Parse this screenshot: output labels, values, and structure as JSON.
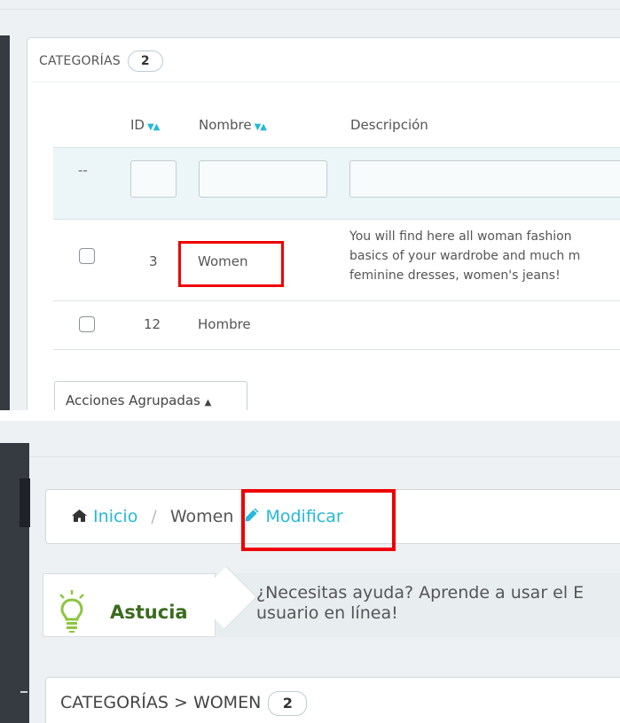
{
  "list": {
    "heading": "CATEGORÍAS",
    "count": "2",
    "columns": {
      "id": "ID",
      "name": "Nombre",
      "description": "Descripción",
      "sort_icon": "▼▲"
    },
    "filter_placeholder": "--",
    "rows": [
      {
        "id": "3",
        "name": "Women",
        "desc_lines": [
          "You will find here all woman fashion",
          "basics of your wardrobe and much m",
          "feminine dresses, women's jeans!"
        ]
      },
      {
        "id": "12",
        "name": "Hombre"
      }
    ],
    "bulk_actions": "Acciones Agrupadas",
    "bulk_caret": "▲"
  },
  "edit": {
    "breadcrumb": {
      "home": "Inicio",
      "separator": "/",
      "current": "Women",
      "modify": "Modificar"
    },
    "tip": {
      "label": "Astucia",
      "text_line1": "¿Necesitas ayuda? Aprende a usar el E",
      "text_line2": "usuario en línea!"
    },
    "section_title": "CATEGORÍAS > WOMEN",
    "section_count": "2"
  },
  "colors": {
    "accent": "#25b9d7",
    "highlight": "#ee0000",
    "tip_green": "#3a6b1e"
  },
  "icons": [
    "sort-icon",
    "home-icon",
    "pencil-icon",
    "lightbulb-icon",
    "caret-up-icon"
  ]
}
